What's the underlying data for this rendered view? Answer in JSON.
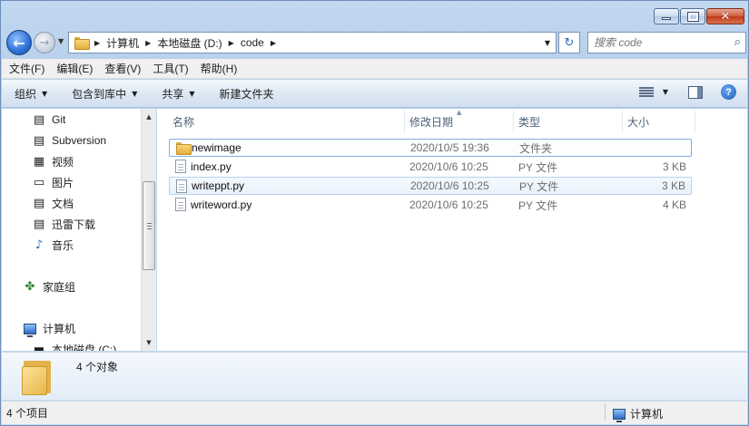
{
  "window": {
    "caption_buttons": {
      "minimize": "minimize",
      "maximize": "maximize",
      "close": "✕"
    }
  },
  "address": {
    "crumbs": [
      "计算机",
      "本地磁盘 (D:)",
      "code"
    ],
    "search_placeholder": "搜索 code"
  },
  "menu": [
    "文件(F)",
    "编辑(E)",
    "查看(V)",
    "工具(T)",
    "帮助(H)"
  ],
  "commands": {
    "organize": "组织",
    "include_in_library": "包含到库中",
    "share": "共享",
    "new_folder": "新建文件夹"
  },
  "nav": {
    "items": [
      {
        "label": "Git",
        "icon": "git-icon"
      },
      {
        "label": "Subversion",
        "icon": "document-icon"
      },
      {
        "label": "视频",
        "icon": "video-icon"
      },
      {
        "label": "图片",
        "icon": "picture-icon"
      },
      {
        "label": "文档",
        "icon": "document-icon"
      },
      {
        "label": "迅雷下载",
        "icon": "download-icon"
      },
      {
        "label": "音乐",
        "icon": "music-icon"
      }
    ],
    "homegroup": "家庭组",
    "computer": "计算机",
    "local_disk": "本地磁盘 (C:)"
  },
  "columns": {
    "name": "名称",
    "modified": "修改日期",
    "type": "类型",
    "size": "大小"
  },
  "files": [
    {
      "name": "newimage",
      "modified": "2020/10/5 19:36",
      "type": "文件夹",
      "size": "",
      "icon": "folder-icon"
    },
    {
      "name": "index.py",
      "modified": "2020/10/6 10:25",
      "type": "PY 文件",
      "size": "3 KB",
      "icon": "py-file-icon"
    },
    {
      "name": "writeppt.py",
      "modified": "2020/10/6 10:25",
      "type": "PY 文件",
      "size": "3 KB",
      "icon": "py-file-icon"
    },
    {
      "name": "writeword.py",
      "modified": "2020/10/6 10:25",
      "type": "PY 文件",
      "size": "4 KB",
      "icon": "py-file-icon"
    }
  ],
  "details": {
    "object_count": "4 个对象"
  },
  "status": {
    "items": "4 个项目",
    "location": "计算机"
  }
}
